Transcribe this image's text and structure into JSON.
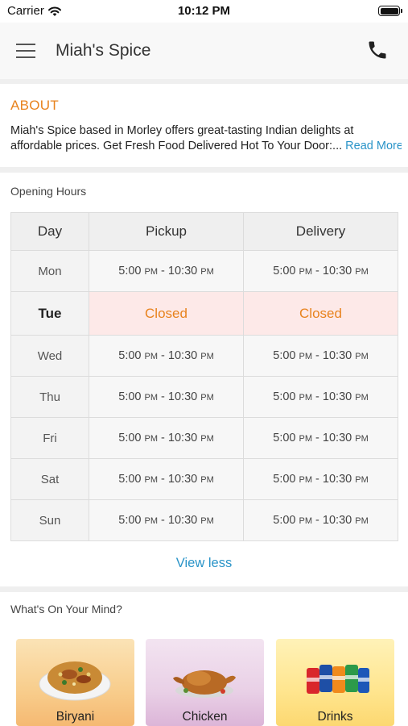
{
  "status_bar": {
    "carrier": "Carrier",
    "time": "10:12 PM"
  },
  "nav": {
    "title": "Miah's Spice",
    "menu_icon": "hamburger-menu-icon",
    "phone_icon": "phone-icon"
  },
  "about": {
    "title": "ABOUT",
    "line1": "Miah's Spice based in Morley offers great-tasting Indian delights at",
    "line2": "affordable prices. Get Fresh Food Delivered Hot To Your Door:",
    "ellipsis": "...",
    "read_more": "Read More"
  },
  "hours": {
    "title": "Opening Hours",
    "headers": {
      "day": "Day",
      "pickup": "Pickup",
      "delivery": "Delivery"
    },
    "closed_label": "Closed",
    "rows": [
      {
        "day": "Mon",
        "pickup_from": "5:00",
        "pickup_from_ampm": "PM",
        "pickup_to": "10:30",
        "pickup_to_ampm": "PM",
        "delivery_from": "5:00",
        "delivery_from_ampm": "PM",
        "delivery_to": "10:30",
        "delivery_to_ampm": "PM"
      },
      {
        "day": "Tue",
        "pickup": "Closed",
        "delivery": "Closed"
      },
      {
        "day": "Wed",
        "pickup_from": "5:00",
        "pickup_from_ampm": "PM",
        "pickup_to": "10:30",
        "pickup_to_ampm": "PM",
        "delivery_from": "5:00",
        "delivery_from_ampm": "PM",
        "delivery_to": "10:30",
        "delivery_to_ampm": "PM"
      },
      {
        "day": "Thu",
        "pickup_from": "5:00",
        "pickup_from_ampm": "PM",
        "pickup_to": "10:30",
        "pickup_to_ampm": "PM",
        "delivery_from": "5:00",
        "delivery_from_ampm": "PM",
        "delivery_to": "10:30",
        "delivery_to_ampm": "PM"
      },
      {
        "day": "Fri",
        "pickup_from": "5:00",
        "pickup_from_ampm": "PM",
        "pickup_to": "10:30",
        "pickup_to_ampm": "PM",
        "delivery_from": "5:00",
        "delivery_from_ampm": "PM",
        "delivery_to": "10:30",
        "delivery_to_ampm": "PM"
      },
      {
        "day": "Sat",
        "pickup_from": "5:00",
        "pickup_from_ampm": "PM",
        "pickup_to": "10:30",
        "pickup_to_ampm": "PM",
        "delivery_from": "5:00",
        "delivery_from_ampm": "PM",
        "delivery_to": "10:30",
        "delivery_to_ampm": "PM"
      },
      {
        "day": "Sun",
        "pickup_from": "5:00",
        "pickup_from_ampm": "PM",
        "pickup_to": "10:30",
        "pickup_to_ampm": "PM",
        "delivery_from": "5:00",
        "delivery_from_ampm": "PM",
        "delivery_to": "10:30",
        "delivery_to_ampm": "PM"
      }
    ],
    "view_less": "View less"
  },
  "mind": {
    "title": "What's On Your Mind?",
    "categories": [
      {
        "label": "Biryani",
        "icon": "biryani-dish-icon"
      },
      {
        "label": "Chicken",
        "icon": "roast-chicken-icon"
      },
      {
        "label": "Drinks",
        "icon": "soda-cans-icon"
      }
    ]
  },
  "colors": {
    "accent_orange": "#e8831e",
    "link_blue": "#2a94c8",
    "closed_row_bg": "#fde9e8"
  }
}
